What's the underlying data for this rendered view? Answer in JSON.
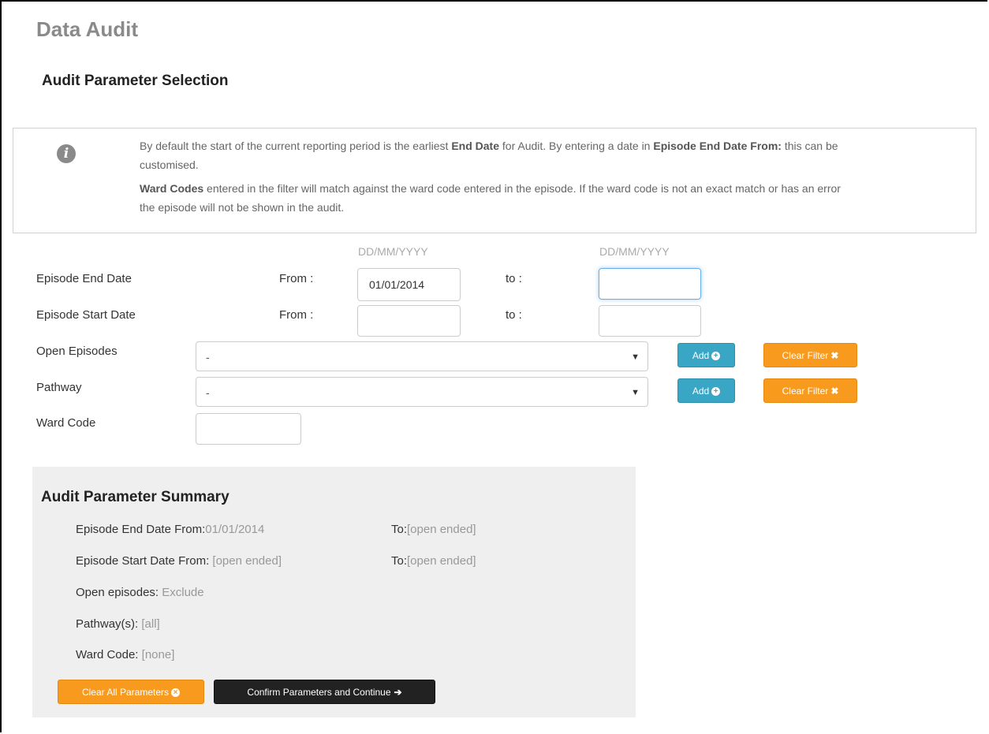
{
  "page": {
    "title": "Data Audit",
    "section_title": "Audit Parameter Selection"
  },
  "info": {
    "p1_a": "By default the start of the current reporting period is the earliest ",
    "p1_b": "End Date",
    "p1_c": " for Audit. By entering a date in ",
    "p1_d": "Episode End Date From:",
    "p1_e": " this can be customised.",
    "p2_a": "Ward Codes",
    "p2_b": " entered in the filter will match against the ward code entered in the episode. If the ward code is not an exact match or has an error the episode will not be shown in the audit."
  },
  "form": {
    "date_format": "DD/MM/YYYY",
    "episode_end_date": {
      "label": "Episode End Date",
      "from_label": "From :",
      "from_value": "01/01/2014",
      "to_label": "to :",
      "to_value": ""
    },
    "episode_start_date": {
      "label": "Episode Start Date",
      "from_label": "From :",
      "from_value": "",
      "to_label": "to :",
      "to_value": ""
    },
    "open_episodes": {
      "label": "Open Episodes",
      "selected": "-",
      "add_label": "Add",
      "clear_label": "Clear Filter"
    },
    "pathway": {
      "label": "Pathway",
      "selected": "-",
      "add_label": "Add",
      "clear_label": "Clear Filter"
    },
    "ward_code": {
      "label": "Ward Code",
      "value": ""
    }
  },
  "summary": {
    "title": "Audit Parameter Summary",
    "end_from_label": "Episode End Date From:",
    "end_from_value": "01/01/2014",
    "end_to_label": "To:",
    "end_to_value": "[open ended]",
    "start_from_label": "Episode Start Date From: ",
    "start_from_value": "[open ended]",
    "start_to_label": "To:",
    "start_to_value": "[open ended]",
    "open_label": "Open episodes: ",
    "open_value": "Exclude",
    "pathway_label": "Pathway(s): ",
    "pathway_value": "[all]",
    "ward_label": "Ward Code: ",
    "ward_value": "[none]",
    "clear_all_label": "Clear All Parameters",
    "confirm_label": "Confirm Parameters and Continue"
  },
  "colors": {
    "info": "#39a6c5",
    "warning": "#f89a1e",
    "dark": "#222222",
    "summary_bg": "#efefef"
  }
}
